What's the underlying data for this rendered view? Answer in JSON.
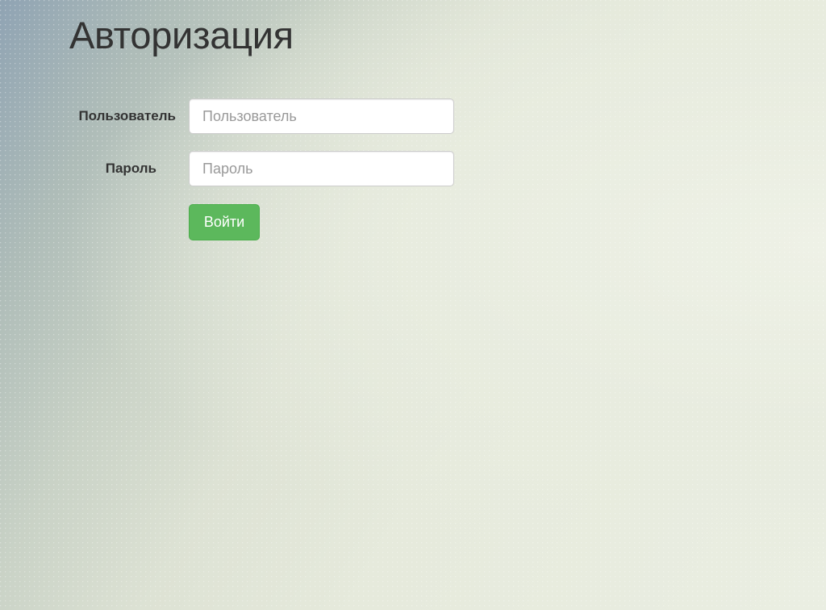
{
  "page": {
    "title": "Авторизация"
  },
  "form": {
    "username": {
      "label": "Пользователь",
      "placeholder": "Пользователь",
      "value": ""
    },
    "password": {
      "label": "Пароль",
      "placeholder": "Пароль",
      "value": ""
    },
    "submit_label": "Войти"
  },
  "colors": {
    "accent_button": "#5cb85c",
    "text": "#333333"
  }
}
